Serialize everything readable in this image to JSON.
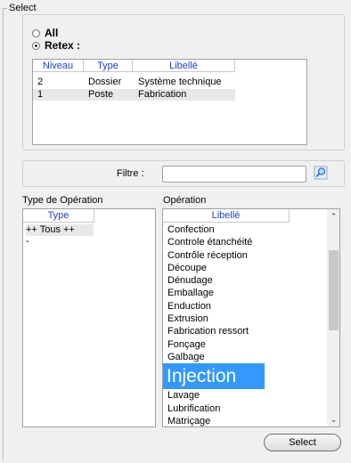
{
  "select_group": {
    "legend": "Select",
    "radio_all": {
      "label": "All",
      "checked": false
    },
    "radio_retex": {
      "label": "Retex :",
      "checked": true
    }
  },
  "retex_grid": {
    "columns": [
      "Niveau",
      "Type",
      "Libellé"
    ],
    "rows": [
      [
        "2",
        "Dossier",
        "Système technique"
      ],
      [
        "1",
        "Poste",
        "Fabrication"
      ]
    ]
  },
  "filter": {
    "label": "Filtre :",
    "value": "",
    "search_icon": "search-icon"
  },
  "type_operation": {
    "label": "Type de Opération",
    "column": "Type",
    "items": [
      "++ Tous ++",
      "-"
    ]
  },
  "operation": {
    "label": "Opération",
    "column": "Libellé",
    "items": [
      "Confection",
      "Controle étanchéité",
      "Contrôle réception",
      "Découpe",
      "Dénudage",
      "Emballage",
      "Enduction",
      "Extrusion",
      "Fabrication ressort",
      "Fonçage",
      "Galbage",
      "Injection",
      "Lavage",
      "Lubrification",
      "Matriçage"
    ],
    "selected": "Injection"
  },
  "select_button": {
    "label": "Select"
  },
  "colors": {
    "header_text": "#1f3fd0",
    "selection": "#3399ff"
  }
}
